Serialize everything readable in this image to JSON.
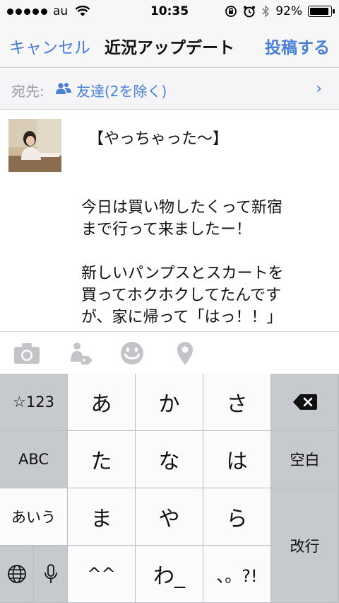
{
  "status_bar": {
    "carrier": "au",
    "time": "10:35",
    "battery": "92%",
    "battery_level": 0.92,
    "icons": [
      "signal-dots",
      "wifi-icon",
      "rotation-lock-icon",
      "alarm-icon",
      "bluetooth-icon",
      "battery-icon"
    ]
  },
  "nav": {
    "cancel_label": "キャンセル",
    "title": "近況アップデート",
    "post_label": "投稿する"
  },
  "audience": {
    "prefix": "宛先:",
    "value": "友達(2を除く)",
    "icon": "friends-icon",
    "chevron": "›"
  },
  "compose": {
    "title_line": "【やっちゃった〜】",
    "body": "今日は買い物したくって新宿\nまで行って来ましたー！\n\n新しいパンプスとスカートを\n買ってホクホクしてたんです\nが、家に帰って「はっ！！」"
  },
  "attach_bar": {
    "icons": [
      "camera-icon",
      "tag-friends-icon",
      "feeling-icon",
      "location-icon"
    ]
  },
  "keyboard": {
    "numbers_key": "☆123",
    "abc_key": "ABC",
    "kana_mode_key": "あいう",
    "globe_icon": "globe-icon",
    "mic_icon": "microphone-icon",
    "row1": [
      "あ",
      "か",
      "さ"
    ],
    "row2": [
      "た",
      "な",
      "は"
    ],
    "row3": [
      "ま",
      "や",
      "ら"
    ],
    "row4": [
      "^^",
      "わ_",
      "、。?!"
    ],
    "delete_icon": "delete-icon",
    "space_key": "空白",
    "return_key": "改行",
    "colors": {
      "key_white": "#fbfbfc",
      "key_gray": "#c6c9ce",
      "accent": "#4a7fd1"
    }
  }
}
